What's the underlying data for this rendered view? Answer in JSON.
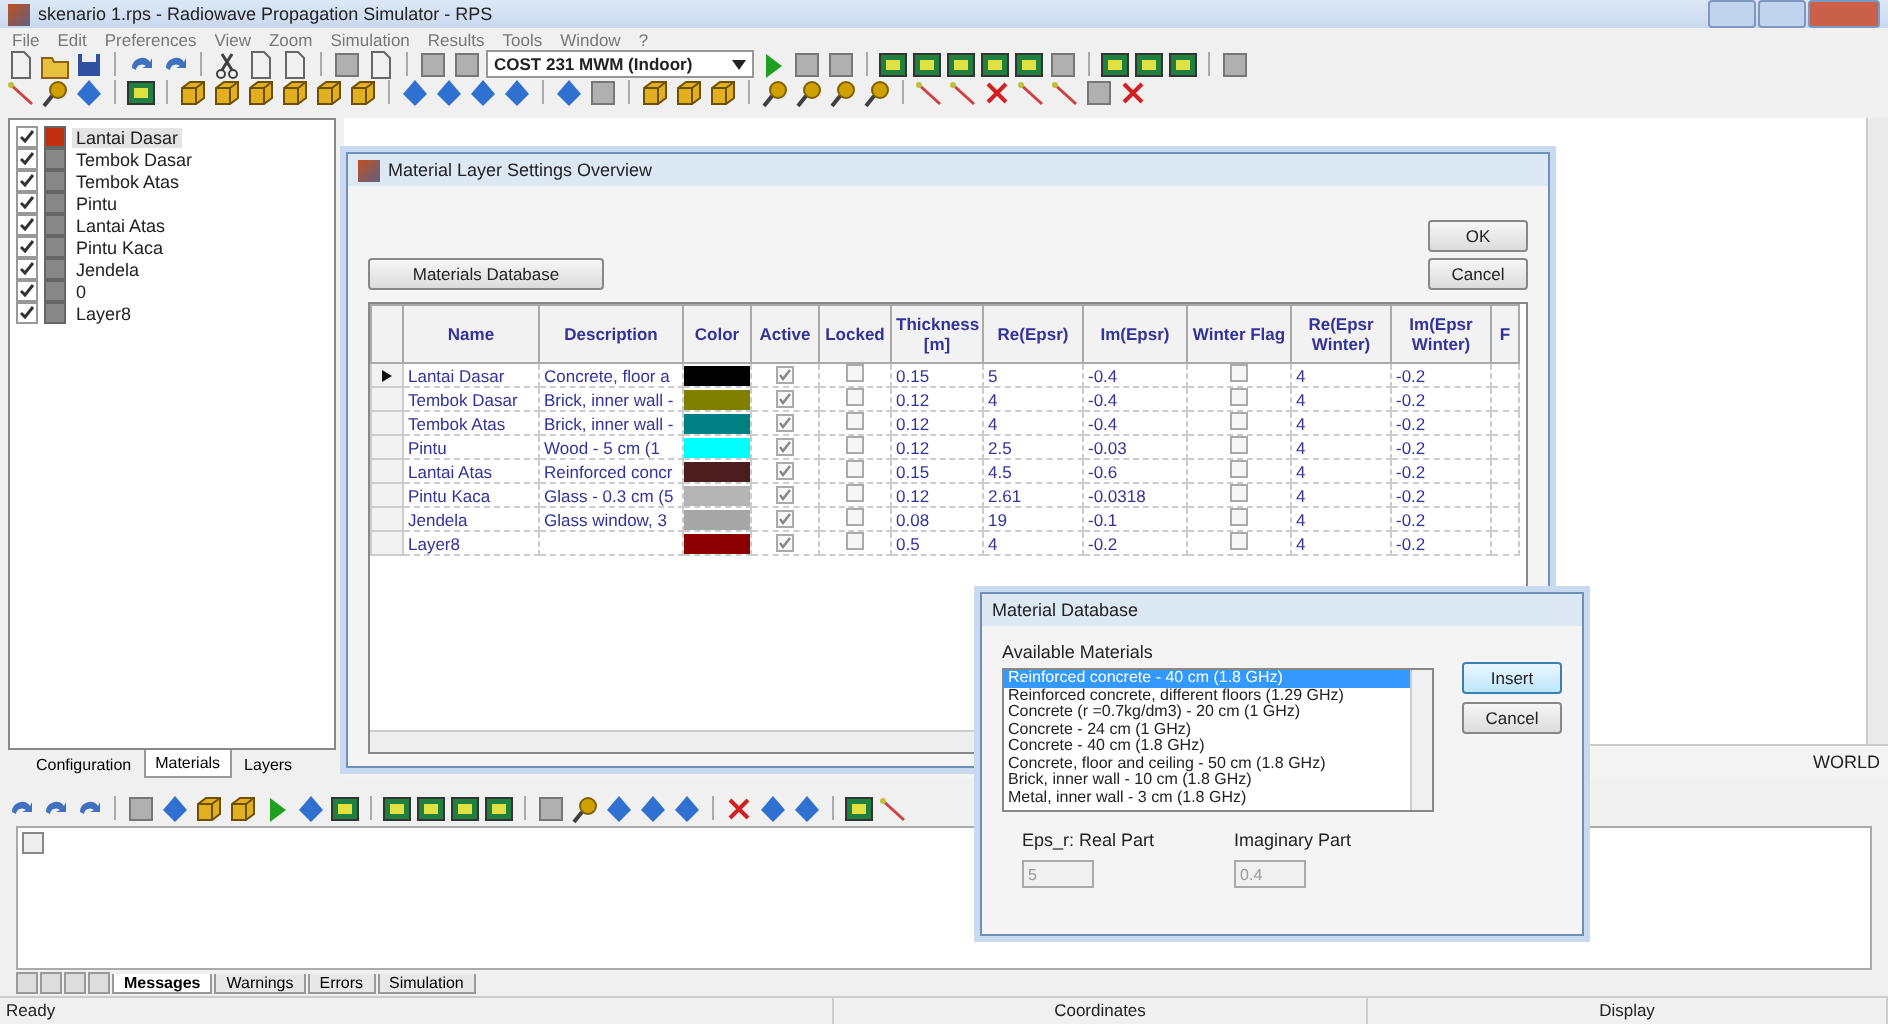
{
  "window": {
    "title": "skenario 1.rps - Radiowave Propagation Simulator - RPS"
  },
  "menu": [
    "File",
    "Edit",
    "Preferences",
    "View",
    "Zoom",
    "Simulation",
    "Results",
    "Tools",
    "Window",
    "?"
  ],
  "toolbar": {
    "model_select": "COST 231 MWM (Indoor)"
  },
  "layers_panel": {
    "items": [
      {
        "label": "Lantai Dasar",
        "checked": true,
        "selected": true
      },
      {
        "label": "Tembok Dasar",
        "checked": true,
        "selected": false
      },
      {
        "label": "Tembok Atas",
        "checked": true,
        "selected": false
      },
      {
        "label": "Pintu",
        "checked": true,
        "selected": false
      },
      {
        "label": "Lantai Atas",
        "checked": true,
        "selected": false
      },
      {
        "label": "Pintu Kaca",
        "checked": true,
        "selected": false
      },
      {
        "label": "Jendela",
        "checked": true,
        "selected": false
      },
      {
        "label": "0",
        "checked": true,
        "selected": false
      },
      {
        "label": "Layer8",
        "checked": true,
        "selected": false
      }
    ],
    "tabs": [
      {
        "label": "Configuration",
        "selected": false
      },
      {
        "label": "Materials",
        "selected": true
      },
      {
        "label": "Layers",
        "selected": false
      }
    ]
  },
  "view": {
    "label": "WORLD"
  },
  "layer_dialog": {
    "title": "Material Layer Settings Overview",
    "database_button": "Materials Database",
    "buttons": [
      "OK",
      "Cancel"
    ],
    "table": {
      "columns": [
        "Name",
        "Description",
        "Color",
        "Active",
        "Locked",
        "Thickness [m]",
        "Re(Epsr)",
        "Im(Epsr)",
        "Winter Flag",
        "Re(Epsr Winter)",
        "Im(Epsr Winter)",
        "F"
      ],
      "rows": [
        {
          "current": true,
          "name": "Lantai Dasar",
          "description": "Concrete, floor a",
          "color": "#000000",
          "active": true,
          "locked": false,
          "thickness": "0.15",
          "re_epsr": "5",
          "im_epsr": "-0.4",
          "winter_flag": false,
          "re_epsr_winter": "4",
          "im_epsr_winter": "-0.2"
        },
        {
          "current": false,
          "name": "Tembok Dasar",
          "description": "Brick, inner wall -",
          "color": "#808000",
          "active": true,
          "locked": false,
          "thickness": "0.12",
          "re_epsr": "4",
          "im_epsr": "-0.4",
          "winter_flag": false,
          "re_epsr_winter": "4",
          "im_epsr_winter": "-0.2"
        },
        {
          "current": false,
          "name": "Tembok Atas",
          "description": "Brick, inner wall -",
          "color": "#008080",
          "active": true,
          "locked": false,
          "thickness": "0.12",
          "re_epsr": "4",
          "im_epsr": "-0.4",
          "winter_flag": false,
          "re_epsr_winter": "4",
          "im_epsr_winter": "-0.2"
        },
        {
          "current": false,
          "name": "Pintu",
          "description": "Wood - 5 cm (1",
          "color": "#00ffff",
          "active": true,
          "locked": false,
          "thickness": "0.12",
          "re_epsr": "2.5",
          "im_epsr": "-0.03",
          "winter_flag": false,
          "re_epsr_winter": "4",
          "im_epsr_winter": "-0.2"
        },
        {
          "current": false,
          "name": "Lantai Atas",
          "description": "Reinforced concr",
          "color": "#4a1e1e",
          "active": true,
          "locked": false,
          "thickness": "0.15",
          "re_epsr": "4.5",
          "im_epsr": "-0.6",
          "winter_flag": false,
          "re_epsr_winter": "4",
          "im_epsr_winter": "-0.2"
        },
        {
          "current": false,
          "name": "Pintu Kaca",
          "description": "Glass - 0.3 cm (5",
          "color": "#b4b4b4",
          "active": true,
          "locked": false,
          "thickness": "0.12",
          "re_epsr": "2.61",
          "im_epsr": "-0.0318",
          "winter_flag": false,
          "re_epsr_winter": "4",
          "im_epsr_winter": "-0.2"
        },
        {
          "current": false,
          "name": "Jendela",
          "description": "Glass window, 3",
          "color": "#a6a6a6",
          "active": true,
          "locked": false,
          "thickness": "0.08",
          "re_epsr": "19",
          "im_epsr": "-0.1",
          "winter_flag": false,
          "re_epsr_winter": "4",
          "im_epsr_winter": "-0.2"
        },
        {
          "current": false,
          "name": "Layer8",
          "description": "",
          "color": "#8b0000",
          "active": true,
          "locked": false,
          "thickness": "0.5",
          "re_epsr": "4",
          "im_epsr": "-0.2",
          "winter_flag": false,
          "re_epsr_winter": "4",
          "im_epsr_winter": "-0.2"
        }
      ]
    }
  },
  "database_dialog": {
    "title": "Material Database",
    "list_label": "Available Materials",
    "materials": [
      {
        "label": "Reinforced concrete - 40 cm (1.8 GHz)",
        "selected": true
      },
      {
        "label": "Reinforced concrete, different floors (1.29 GHz)",
        "selected": false
      },
      {
        "label": "Concrete (r =0.7kg/dm3) - 20 cm (1 GHz)",
        "selected": false
      },
      {
        "label": "Concrete - 24 cm (1 GHz)",
        "selected": false
      },
      {
        "label": "Concrete - 40 cm (1.8 GHz)",
        "selected": false
      },
      {
        "label": "Concrete, floor and ceiling - 50 cm (1.8 GHz)",
        "selected": false
      },
      {
        "label": "Brick, inner wall - 10 cm (1.8 GHz)",
        "selected": false
      },
      {
        "label": "Metal, inner wall - 3 cm (1.8 GHz)",
        "selected": false
      }
    ],
    "buttons": [
      {
        "label": "Insert",
        "focused": true
      },
      {
        "label": "Cancel",
        "focused": false
      }
    ],
    "fields": [
      {
        "label": "Eps_r: Real Part",
        "value": "5",
        "disabled": true
      },
      {
        "label": "Imaginary Part",
        "value": "0.4",
        "disabled": true
      }
    ]
  },
  "messages": {
    "tabs": [
      {
        "label": "Messages",
        "selected": true
      },
      {
        "label": "Warnings",
        "selected": false
      },
      {
        "label": "Errors",
        "selected": false
      },
      {
        "label": "Simulation",
        "selected": false
      }
    ]
  },
  "status_bar": [
    "Ready",
    "Coordinates",
    "Display"
  ]
}
